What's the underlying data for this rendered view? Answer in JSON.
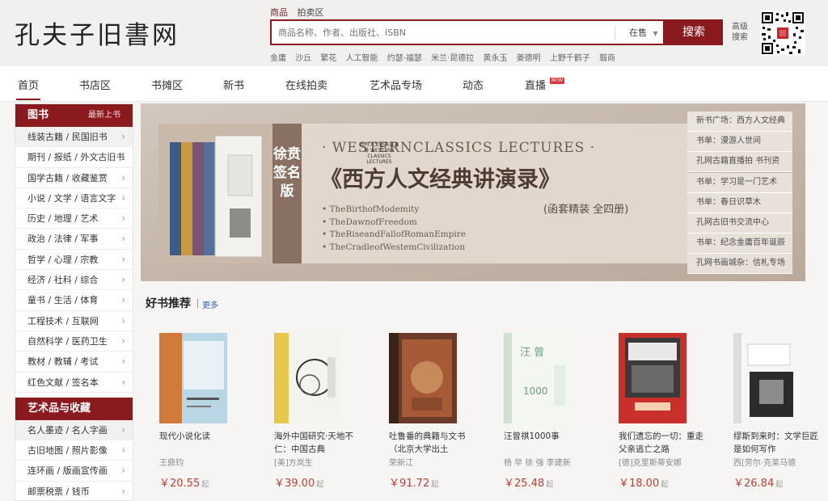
{
  "site": {
    "logo": "孔夫子旧書网"
  },
  "search": {
    "tabs": [
      "商品",
      "拍卖区"
    ],
    "placeholder": "商品名称、作者、出版社、ISBN",
    "scope": "在售",
    "button": "搜索",
    "advanced": "高级搜索",
    "hot": [
      "金庸",
      "沙丘",
      "繁花",
      "人工智能",
      "约瑟·福瑟",
      "米兰·昆德拉",
      "黄永玉",
      "姜德明",
      "上野千鹤子",
      "翦商"
    ]
  },
  "nav": {
    "items": [
      "首页",
      "书店区",
      "书摊区",
      "新书",
      "在线拍卖",
      "艺术品专场",
      "动态",
      "直播"
    ],
    "new_badge": "NEW"
  },
  "sidebar": {
    "books_title": "图书",
    "books_sub": "最新上书",
    "books": [
      "线装古籍 / 民国旧书",
      "期刊 / 报纸 / 外文古旧书",
      "国学古籍 / 收藏鉴赏",
      "小说 / 文学 / 语言文字",
      "历史 / 地理 / 艺术",
      "政治 / 法律 / 军事",
      "哲学 / 心理 / 宗教",
      "经济 / 社科 / 综合",
      "童书 / 生活 / 体育",
      "工程技术 / 互联网",
      "自然科学 / 医药卫生",
      "教材 / 教辅 / 考试",
      "红色文献 / 签名本"
    ],
    "art_title": "艺术品与收藏",
    "art": [
      "名人墨迹 / 名人字画",
      "古旧地图 / 照片影像",
      "连环画 / 版画宣传画",
      "邮票税票 / 钱币"
    ]
  },
  "banner": {
    "vertical": "徐贲签名版",
    "en_title": "· WESTERNCLASSICS LECTURES ·",
    "cn_title": "《西方人文经典讲演录》",
    "subtitle": "(函套精装 全四册)",
    "lectures": [
      "TheBirthofModemity",
      "TheDawnofFreedom",
      "TheRiseandFallofRomanEmpire",
      "TheCradleofWestemCivilization"
    ],
    "box_text": "西方人文经典讲演录 WESTERN CLASSICS LECTURES"
  },
  "right_links": [
    "新书广场：西方人文经典",
    "书单：漫游人世间",
    "孔网古籍直播拍 书刊资",
    "书单：学习是一门艺术",
    "书单：春日识草木",
    "孔网古旧书交流中心",
    "书单：纪念金庸百年诞辰",
    "孔网书画城杂：信札专场"
  ],
  "recommend": {
    "title": "好书推荐",
    "more": "更多",
    "price_suffix": "起",
    "books": [
      {
        "title": "现代小说化读",
        "author": "王鼎钧",
        "price": "￥20.55"
      },
      {
        "title": "海外中国研究·天地不仁：中国古典",
        "author": "[美]方岚生",
        "price": "￥39.00"
      },
      {
        "title": "吐鲁番的典籍与文书（北京大学出土",
        "author": "荣新江",
        "price": "￥91.72"
      },
      {
        "title": "汪曾祺1000事",
        "author": "杨 早 徐 强 李建新",
        "price": "￥25.48"
      },
      {
        "title": "我们遗忘的一切：重走父亲逃亡之路",
        "author": "[德]克里斯蒂安娜",
        "price": "￥18.00"
      },
      {
        "title": "缪斯到来时：文学巨匠是如何写作",
        "author": "西[劳尔·克莱马德",
        "price": "￥26.84"
      }
    ]
  },
  "colors": {
    "brand": "#8b1a1f",
    "price": "#b84034",
    "link": "#3461a8"
  }
}
